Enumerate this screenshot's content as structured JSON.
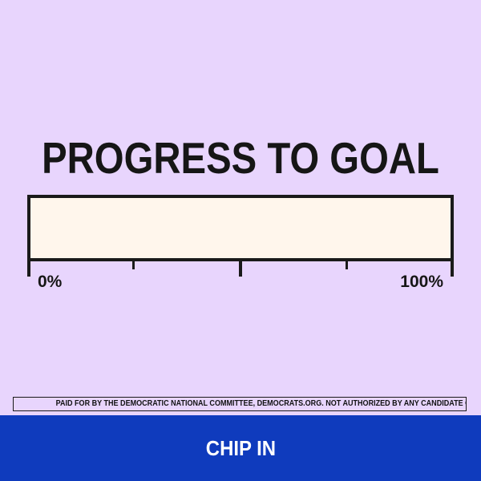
{
  "headline": "PROGRESS TO GOAL",
  "progress": {
    "value_fraction": 0,
    "start_label": "0%",
    "end_label": "100%"
  },
  "disclaimer": "PAID FOR BY THE DEMOCRATIC NATIONAL COMMITTEE, DEMOCRATS.ORG. NOT AUTHORIZED BY ANY CANDIDATE OR CANDIDATE'S COMMITTEE.",
  "cta": {
    "label": "CHIP IN"
  },
  "colors": {
    "background": "#e8d5fd",
    "bar_background": "#fff6ec",
    "bar_border": "#1a1a1a",
    "cta_background": "#0f3bbd",
    "cta_text": "#ffffff"
  }
}
